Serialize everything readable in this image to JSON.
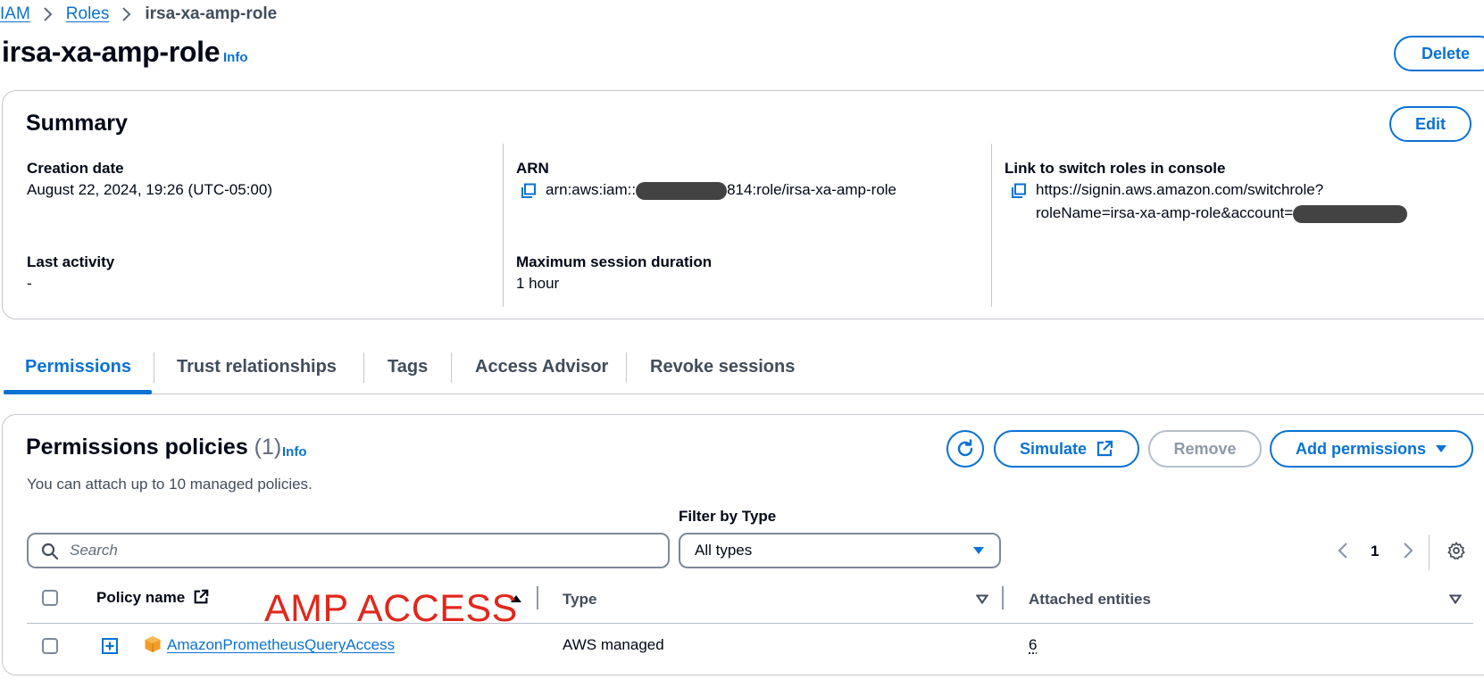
{
  "breadcrumb": {
    "items": [
      "IAM",
      "Roles",
      "irsa-xa-amp-role"
    ]
  },
  "page": {
    "title": "irsa-xa-amp-role",
    "info": "Info",
    "delete_label": "Delete"
  },
  "summary": {
    "title": "Summary",
    "edit_label": "Edit",
    "creation_date_label": "Creation date",
    "creation_date": "August 22, 2024, 19:26 (UTC-05:00)",
    "last_activity_label": "Last activity",
    "last_activity": "-",
    "arn_label": "ARN",
    "arn_prefix": "arn:aws:iam::",
    "arn_suffix": "814:role/irsa-xa-amp-role",
    "max_session_label": "Maximum session duration",
    "max_session": "1 hour",
    "switch_label": "Link to switch roles in console",
    "switch_line1": "https://signin.aws.amazon.com/switchrole?",
    "switch_line2": "roleName=irsa-xa-amp-role&account="
  },
  "tabs": [
    "Permissions",
    "Trust relationships",
    "Tags",
    "Access Advisor",
    "Revoke sessions"
  ],
  "permissions": {
    "title": "Permissions policies",
    "count": "(1)",
    "info": "Info",
    "description": "You can attach up to 10 managed policies.",
    "simulate_label": "Simulate",
    "remove_label": "Remove",
    "add_label": "Add permissions",
    "filter_label": "Filter by Type",
    "filter_value": "All types",
    "search_placeholder": "Search",
    "page_number": "1",
    "columns": {
      "policy_name": "Policy name",
      "type": "Type",
      "attached": "Attached entities"
    },
    "rows": [
      {
        "policy_name": "AmazonPrometheusQueryAccess",
        "type": "AWS managed",
        "attached": "6"
      }
    ]
  },
  "annotation": "AMP ACCESS",
  "colors": {
    "accent": "#0972d3",
    "annotation": "#e0281c",
    "policy_icon": "#f29d28"
  },
  "icons": [
    "chevron-right-icon",
    "copy-icon",
    "refresh-icon",
    "external-link-icon",
    "caret-down-icon",
    "search-icon",
    "gear-icon",
    "expand-icon",
    "policy-icon",
    "sort-ascending-icon",
    "sort-icon"
  ]
}
